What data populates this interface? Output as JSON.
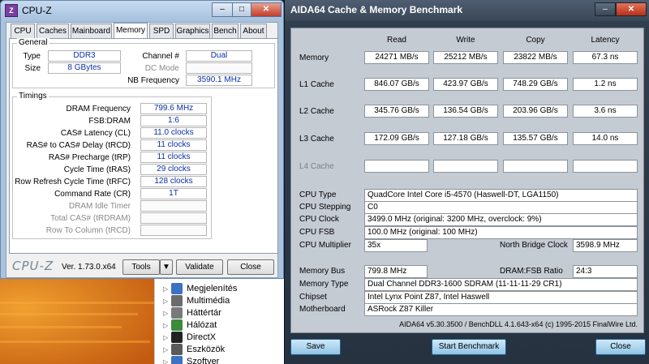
{
  "desktop": {
    "explorer_items": [
      {
        "label": "Megjelenítés",
        "icon": "display-icon",
        "color": "#3a72c4"
      },
      {
        "label": "Multimédia",
        "icon": "speaker-icon",
        "color": "#6b6b6b"
      },
      {
        "label": "Háttértár",
        "icon": "drive-icon",
        "color": "#7a7a7a"
      },
      {
        "label": "Hálózat",
        "icon": "network-icon",
        "color": "#3c8a3c"
      },
      {
        "label": "DirectX",
        "icon": "directx-icon",
        "color": "#222222"
      },
      {
        "label": "Eszközök",
        "icon": "devices-icon",
        "color": "#5a5a5a"
      },
      {
        "label": "Szoftver",
        "icon": "software-icon",
        "color": "#3a72c4"
      }
    ]
  },
  "cpuz": {
    "title": "CPU-Z",
    "tabs": [
      "CPU",
      "Caches",
      "Mainboard",
      "Memory",
      "SPD",
      "Graphics",
      "Bench",
      "About"
    ],
    "active_tab": "Memory",
    "general": {
      "title": "General",
      "type_label": "Type",
      "type_value": "DDR3",
      "size_label": "Size",
      "size_value": "8 GBytes",
      "channel_label": "Channel #",
      "channel_value": "Dual",
      "dcmode_label": "DC Mode",
      "dcmode_value": "",
      "nbfreq_label": "NB Frequency",
      "nbfreq_value": "3590.1 MHz"
    },
    "timings": {
      "title": "Timings",
      "rows": [
        {
          "label": "DRAM Frequency",
          "value": "799.6 MHz",
          "dim": false
        },
        {
          "label": "FSB:DRAM",
          "value": "1:6",
          "dim": false
        },
        {
          "label": "CAS# Latency (CL)",
          "value": "11.0 clocks",
          "dim": false
        },
        {
          "label": "RAS# to CAS# Delay (tRCD)",
          "value": "11 clocks",
          "dim": false
        },
        {
          "label": "RAS# Precharge (tRP)",
          "value": "11 clocks",
          "dim": false
        },
        {
          "label": "Cycle Time (tRAS)",
          "value": "29 clocks",
          "dim": false
        },
        {
          "label": "Row Refresh Cycle Time (tRFC)",
          "value": "128 clocks",
          "dim": false
        },
        {
          "label": "Command Rate (CR)",
          "value": "1T",
          "dim": false
        },
        {
          "label": "DRAM Idle Timer",
          "value": "",
          "dim": true
        },
        {
          "label": "Total CAS# (tRDRAM)",
          "value": "",
          "dim": true
        },
        {
          "label": "Row To Column (tRCD)",
          "value": "",
          "dim": true
        }
      ]
    },
    "footer": {
      "logo": "CPU-Z",
      "version": "Ver. 1.73.0.x64",
      "tools": "Tools",
      "validate": "Validate",
      "close": "Close"
    }
  },
  "aida": {
    "title": "AIDA64 Cache & Memory Benchmark",
    "columns": [
      "Read",
      "Write",
      "Copy",
      "Latency"
    ],
    "bench_rows": [
      {
        "label": "Memory",
        "values": [
          "24271 MB/s",
          "25212 MB/s",
          "23822 MB/s",
          "67.3 ns"
        ],
        "dim": false
      },
      {
        "label": "L1 Cache",
        "values": [
          "846.07 GB/s",
          "423.97 GB/s",
          "748.29 GB/s",
          "1.2 ns"
        ],
        "dim": false
      },
      {
        "label": "L2 Cache",
        "values": [
          "345.76 GB/s",
          "136.54 GB/s",
          "203.96 GB/s",
          "3.6 ns"
        ],
        "dim": false
      },
      {
        "label": "L3 Cache",
        "values": [
          "172.09 GB/s",
          "127.18 GB/s",
          "135.57 GB/s",
          "14.0 ns"
        ],
        "dim": false
      },
      {
        "label": "L4 Cache",
        "values": [
          "",
          "",
          "",
          ""
        ],
        "dim": true
      }
    ],
    "info": {
      "cpu_type_label": "CPU Type",
      "cpu_type": "QuadCore Intel Core i5-4570  (Haswell-DT, LGA1150)",
      "cpu_stepping_label": "CPU Stepping",
      "cpu_stepping": "C0",
      "cpu_clock_label": "CPU Clock",
      "cpu_clock": "3499.0 MHz  (original: 3200 MHz, overclock: 9%)",
      "cpu_fsb_label": "CPU FSB",
      "cpu_fsb": "100.0 MHz  (original: 100 MHz)",
      "cpu_mult_label": "CPU Multiplier",
      "cpu_mult": "35x",
      "nb_clock_label": "North Bridge Clock",
      "nb_clock": "3598.9 MHz",
      "mem_bus_label": "Memory Bus",
      "mem_bus": "799.8 MHz",
      "dram_fsb_label": "DRAM:FSB Ratio",
      "dram_fsb": "24:3",
      "mem_type_label": "Memory Type",
      "mem_type": "Dual Channel DDR3-1600 SDRAM  (11-11-11-29 CR1)",
      "chipset_label": "Chipset",
      "chipset": "Intel Lynx Point Z87, Intel Haswell",
      "mobo_label": "Motherboard",
      "mobo": "ASRock Z87 Killer"
    },
    "footer_text": "AIDA64 v5.30.3500 / BenchDLL 4.1.643-x64  (c) 1995-2015 FinalWire Ltd.",
    "buttons": {
      "save": "Save",
      "start": "Start Benchmark",
      "close": "Close"
    }
  },
  "colors": {
    "value_blue": "#0b2fa6",
    "aida_bg": "#313f50",
    "aida_panel": "#c5cbd3"
  }
}
